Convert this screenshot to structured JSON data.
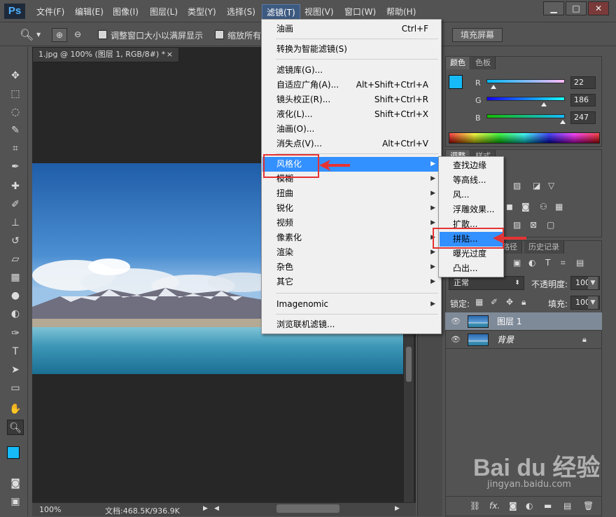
{
  "app": {
    "logo": "Ps"
  },
  "menubar": {
    "items": [
      "文件(F)",
      "编辑(E)",
      "图像(I)",
      "图层(L)",
      "类型(Y)",
      "选择(S)",
      "滤镜(T)",
      "视图(V)",
      "窗口(W)",
      "帮助(H)"
    ],
    "window_buttons": [
      "▁",
      "□",
      "✕"
    ]
  },
  "options_bar": {
    "resize_windows_label": "调整窗口大小以满屏显示",
    "zoom_all_label": "缩放所有",
    "fill_screen_label": "填充屏幕"
  },
  "document": {
    "tab_title": "1.jpg @ 100% (图层 1, RGB/8#) *",
    "tab_close": "×",
    "zoom": "100%",
    "doc_info": "文档:468.5K/936.9K"
  },
  "color_panel": {
    "tabs": [
      "颜色",
      "色板"
    ],
    "channels": [
      {
        "label": "R",
        "value": "22",
        "fraction": 0.086
      },
      {
        "label": "G",
        "value": "186",
        "fraction": 0.729
      },
      {
        "label": "B",
        "value": "247",
        "fraction": 0.969
      }
    ],
    "foreground": "#16baf7"
  },
  "adjust_panel": {
    "tabs": [
      "调整",
      "样式"
    ]
  },
  "layers_panel": {
    "tabs": [
      "图层",
      "路径",
      "历史记录"
    ],
    "blend_mode": "正常",
    "opacity_label": "不透明度:",
    "opacity_value": "100%",
    "lock_label": "锁定:",
    "fill_label": "填充:",
    "fill_value": "100%",
    "layers": [
      {
        "name": "图层 1",
        "selected": true
      },
      {
        "name": "背景",
        "locked": true
      }
    ]
  },
  "filter_menu": {
    "items": [
      {
        "label": "油画",
        "shortcut": "Ctrl+F"
      },
      {
        "label": "转换为智能滤镜(S)"
      },
      {
        "label": "滤镜库(G)..."
      },
      {
        "label": "自适应广角(A)...",
        "shortcut": "Alt+Shift+Ctrl+A"
      },
      {
        "label": "镜头校正(R)...",
        "shortcut": "Shift+Ctrl+R"
      },
      {
        "label": "液化(L)...",
        "shortcut": "Shift+Ctrl+X"
      },
      {
        "label": "油画(O)..."
      },
      {
        "label": "消失点(V)...",
        "shortcut": "Alt+Ctrl+V"
      },
      {
        "label": "风格化",
        "submenu": true,
        "highlighted": true
      },
      {
        "label": "模糊",
        "submenu": true
      },
      {
        "label": "扭曲",
        "submenu": true
      },
      {
        "label": "锐化",
        "submenu": true
      },
      {
        "label": "视频",
        "submenu": true
      },
      {
        "label": "像素化",
        "submenu": true
      },
      {
        "label": "渲染",
        "submenu": true
      },
      {
        "label": "杂色",
        "submenu": true
      },
      {
        "label": "其它",
        "submenu": true
      },
      {
        "label": "Imagenomic",
        "submenu": true
      },
      {
        "label": "浏览联机滤镜..."
      }
    ]
  },
  "stylize_submenu": {
    "items": [
      "查找边缘",
      "等高线...",
      "风...",
      "浮雕效果...",
      "扩散...",
      "拼贴...",
      "曝光过度",
      "凸出..."
    ],
    "highlighted_index": 5
  },
  "colors": {
    "menu_highlight": "#3390ff",
    "annotation_red": "#e53333"
  },
  "watermark": {
    "brand": "Bai du 经验",
    "url": "jingyan.baidu.com"
  }
}
